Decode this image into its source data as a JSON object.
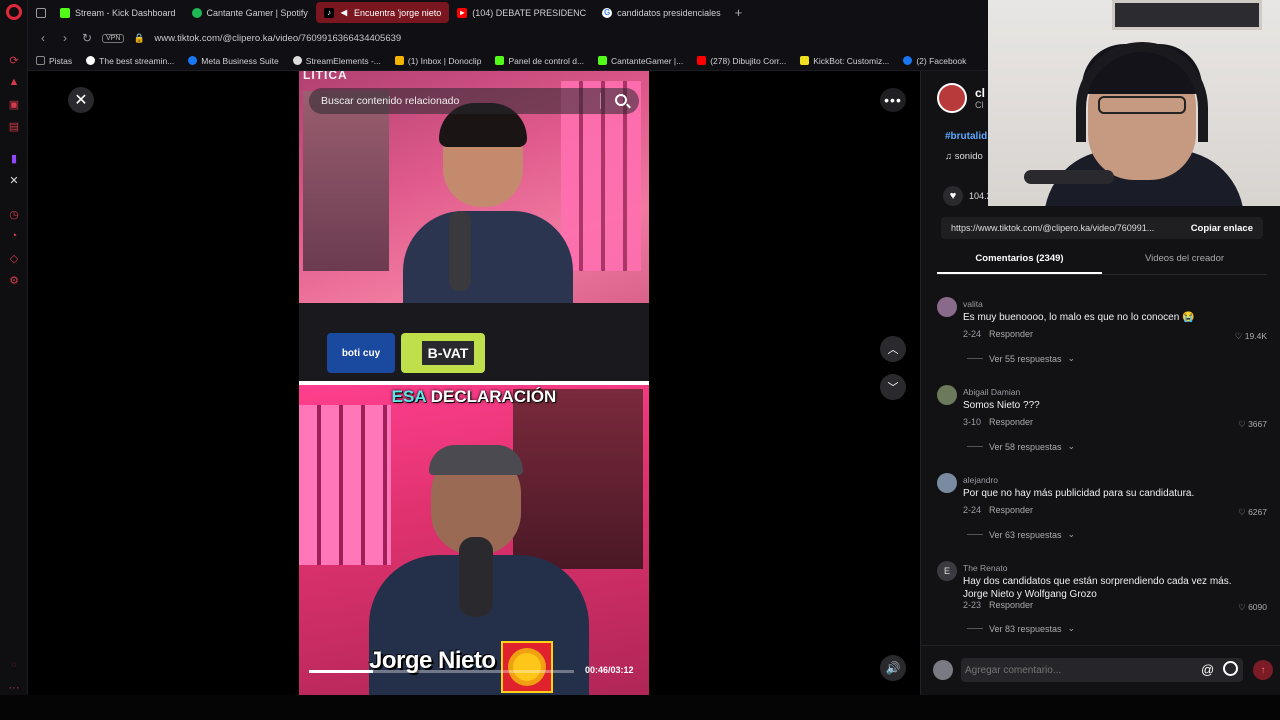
{
  "tabs": [
    {
      "label": "Stream - Kick Dashboard",
      "color": "#53fc18"
    },
    {
      "label": "Cantante Gamer | Spotify",
      "color": "#1db954"
    },
    {
      "label": "Encuentra 'jorge nieto",
      "color": "#ffffff"
    },
    {
      "label": "(104) DEBATE PRESIDENC",
      "color": "#ff0000"
    },
    {
      "label": "candidatos presidenciales",
      "color": "#4285f4"
    }
  ],
  "address": {
    "url": "www.tiktok.com/@clipero.ka/video/7609916366434405639",
    "vpn": "VPN"
  },
  "bookmarks": [
    {
      "label": "Pistas",
      "color": "#888888"
    },
    {
      "label": "The best streamin...",
      "color": "#ffffff"
    },
    {
      "label": "Meta Business Suite",
      "color": "#1877f2"
    },
    {
      "label": "StreamElements -...",
      "color": "#dddddd"
    },
    {
      "label": "(1) Inbox | Donoclip",
      "color": "#f4b400"
    },
    {
      "label": "Panel de control d...",
      "color": "#53fc18"
    },
    {
      "label": "CantanteGamer |...",
      "color": "#53fc18"
    },
    {
      "label": "(278) Dibujito Corr...",
      "color": "#ff0000"
    },
    {
      "label": "KickBot: Customiz...",
      "color": "#f0e020"
    },
    {
      "label": "(2) Facebook",
      "color": "#1877f2"
    }
  ],
  "video": {
    "top_fragment": "LITICA",
    "search_placeholder": "Buscar contenido relacionado",
    "caption_highlight": "ESA",
    "caption_rest": " DECLARACIÓN",
    "logo_left": "boti cuy",
    "logo_right": "B-VAT",
    "name_overlay": "Jorge Nieto",
    "timecode": "00:46/03:12",
    "progress": 0.24
  },
  "panel": {
    "creator_name": "cl",
    "creator_sub": "Cl",
    "hashtag": "#brutalid",
    "sound": "sonido",
    "likes": "104.2",
    "link": "https://www.tiktok.com/@clipero.ka/video/760991...",
    "copy_label": "Copiar enlace",
    "tabs": [
      "Comentarios (2349)",
      "Videos del creador"
    ],
    "reply_label": "Responder",
    "comment_placeholder": "Agregar comentario...",
    "at_symbol": "@"
  },
  "comments": [
    {
      "user": "valita",
      "text": "Es muy buenoooo, lo malo es que no lo conocen 😭",
      "date": "2-24",
      "likes": "19.4K",
      "replies": "Ver 55 respuestas",
      "avatar": ""
    },
    {
      "user": "Abigail Damian",
      "text": "Somos Nieto ???",
      "date": "3-10",
      "likes": "3667",
      "replies": "Ver 58 respuestas",
      "avatar": ""
    },
    {
      "user": "alejandro",
      "text": "Por que no hay más publicidad para su candidatura.",
      "date": "2-24",
      "likes": "6267",
      "replies": "Ver 63 respuestas",
      "avatar": ""
    },
    {
      "user": "The Renato",
      "text": "Hay dos candidatos que están sorprendiendo cada vez más. Jorge Nieto y Wolfgang Grozo",
      "date": "2-23",
      "likes": "6090",
      "replies": "Ver 83 respuestas",
      "avatar": "E"
    }
  ]
}
